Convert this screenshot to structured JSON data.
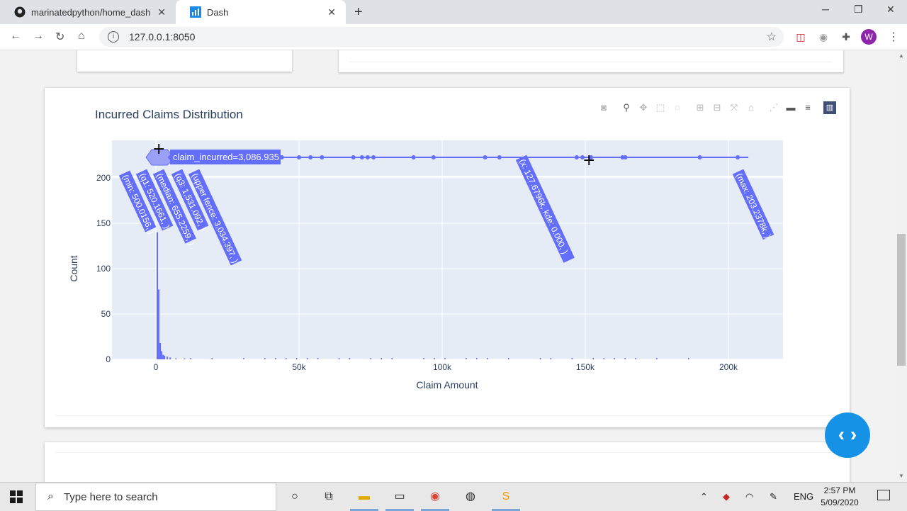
{
  "browser": {
    "tabs": [
      {
        "title": "marinatedpython/home_dash",
        "icon": "github-icon"
      },
      {
        "title": "Dash",
        "icon": "dash-icon"
      }
    ],
    "new_tab": "+",
    "url": "127.0.0.1:8050",
    "profile_initial": "W"
  },
  "chart": {
    "title": "Incurred Claims Distribution",
    "hover_label": "claim_incurred=3,086.935",
    "box_labels": [
      "(min: 500.0156, )",
      "(q1: 520.1661, )",
      "(median: 655.2259, )",
      "(q3: 1,531.092, )",
      "(upper fence: 3,034.397, )",
      "(x: 127.6796k, kde: 0.000, )",
      "(max: 203.2378k, )"
    ],
    "modebar": [
      "camera-icon",
      "zoom-icon",
      "pan-icon",
      "box-select-icon",
      "lasso-icon",
      "zoom-in-icon",
      "zoom-out-icon",
      "autoscale-icon",
      "reset-axes-icon",
      "spike-lines-icon",
      "hover-closest-icon",
      "hover-compare-icon",
      "plotly-logo-icon"
    ]
  },
  "chart_data": {
    "type": "bar",
    "title": "Incurred Claims Distribution",
    "xlabel": "Claim Amount",
    "ylabel": "Count",
    "xlim": [
      -15000,
      220000
    ],
    "ylim": [
      0,
      240
    ],
    "x_ticks": [
      0,
      50000,
      100000,
      150000,
      200000
    ],
    "x_tick_labels": [
      "0",
      "50k",
      "100k",
      "150k",
      "200k"
    ],
    "y_ticks": [
      0,
      50,
      100,
      150,
      200
    ],
    "y_tick_labels": [
      "0",
      "50",
      "100",
      "150",
      "200"
    ],
    "histogram": {
      "x": [
        500,
        1000,
        1500,
        2000,
        2500,
        3000,
        4000,
        5000,
        7000,
        10000
      ],
      "y": [
        140,
        77,
        18,
        9,
        5,
        4,
        3,
        2,
        1,
        1
      ]
    },
    "marginal_box": {
      "min": 500.0156,
      "q1": 520.1661,
      "median": 655.2259,
      "q3": 1531.092,
      "upper_fence": 3034.397,
      "max": 203237.8
    },
    "outliers": [
      5000,
      11000,
      12000,
      35000,
      44000,
      50000,
      54000,
      58000,
      69000,
      72000,
      74000,
      76000,
      90000,
      97000,
      115000,
      120000,
      147000,
      149000,
      152000,
      163000,
      164000,
      190000,
      203237.8
    ],
    "grid": true,
    "color": "#636efa"
  },
  "taskbar": {
    "search_placeholder": "Type here to search",
    "language": "ENG",
    "time": "2:57 PM",
    "date": "5/09/2020"
  },
  "colors": {
    "plot_bg": "#e5ecf6",
    "accent": "#636efa",
    "fab": "#1592e6"
  }
}
